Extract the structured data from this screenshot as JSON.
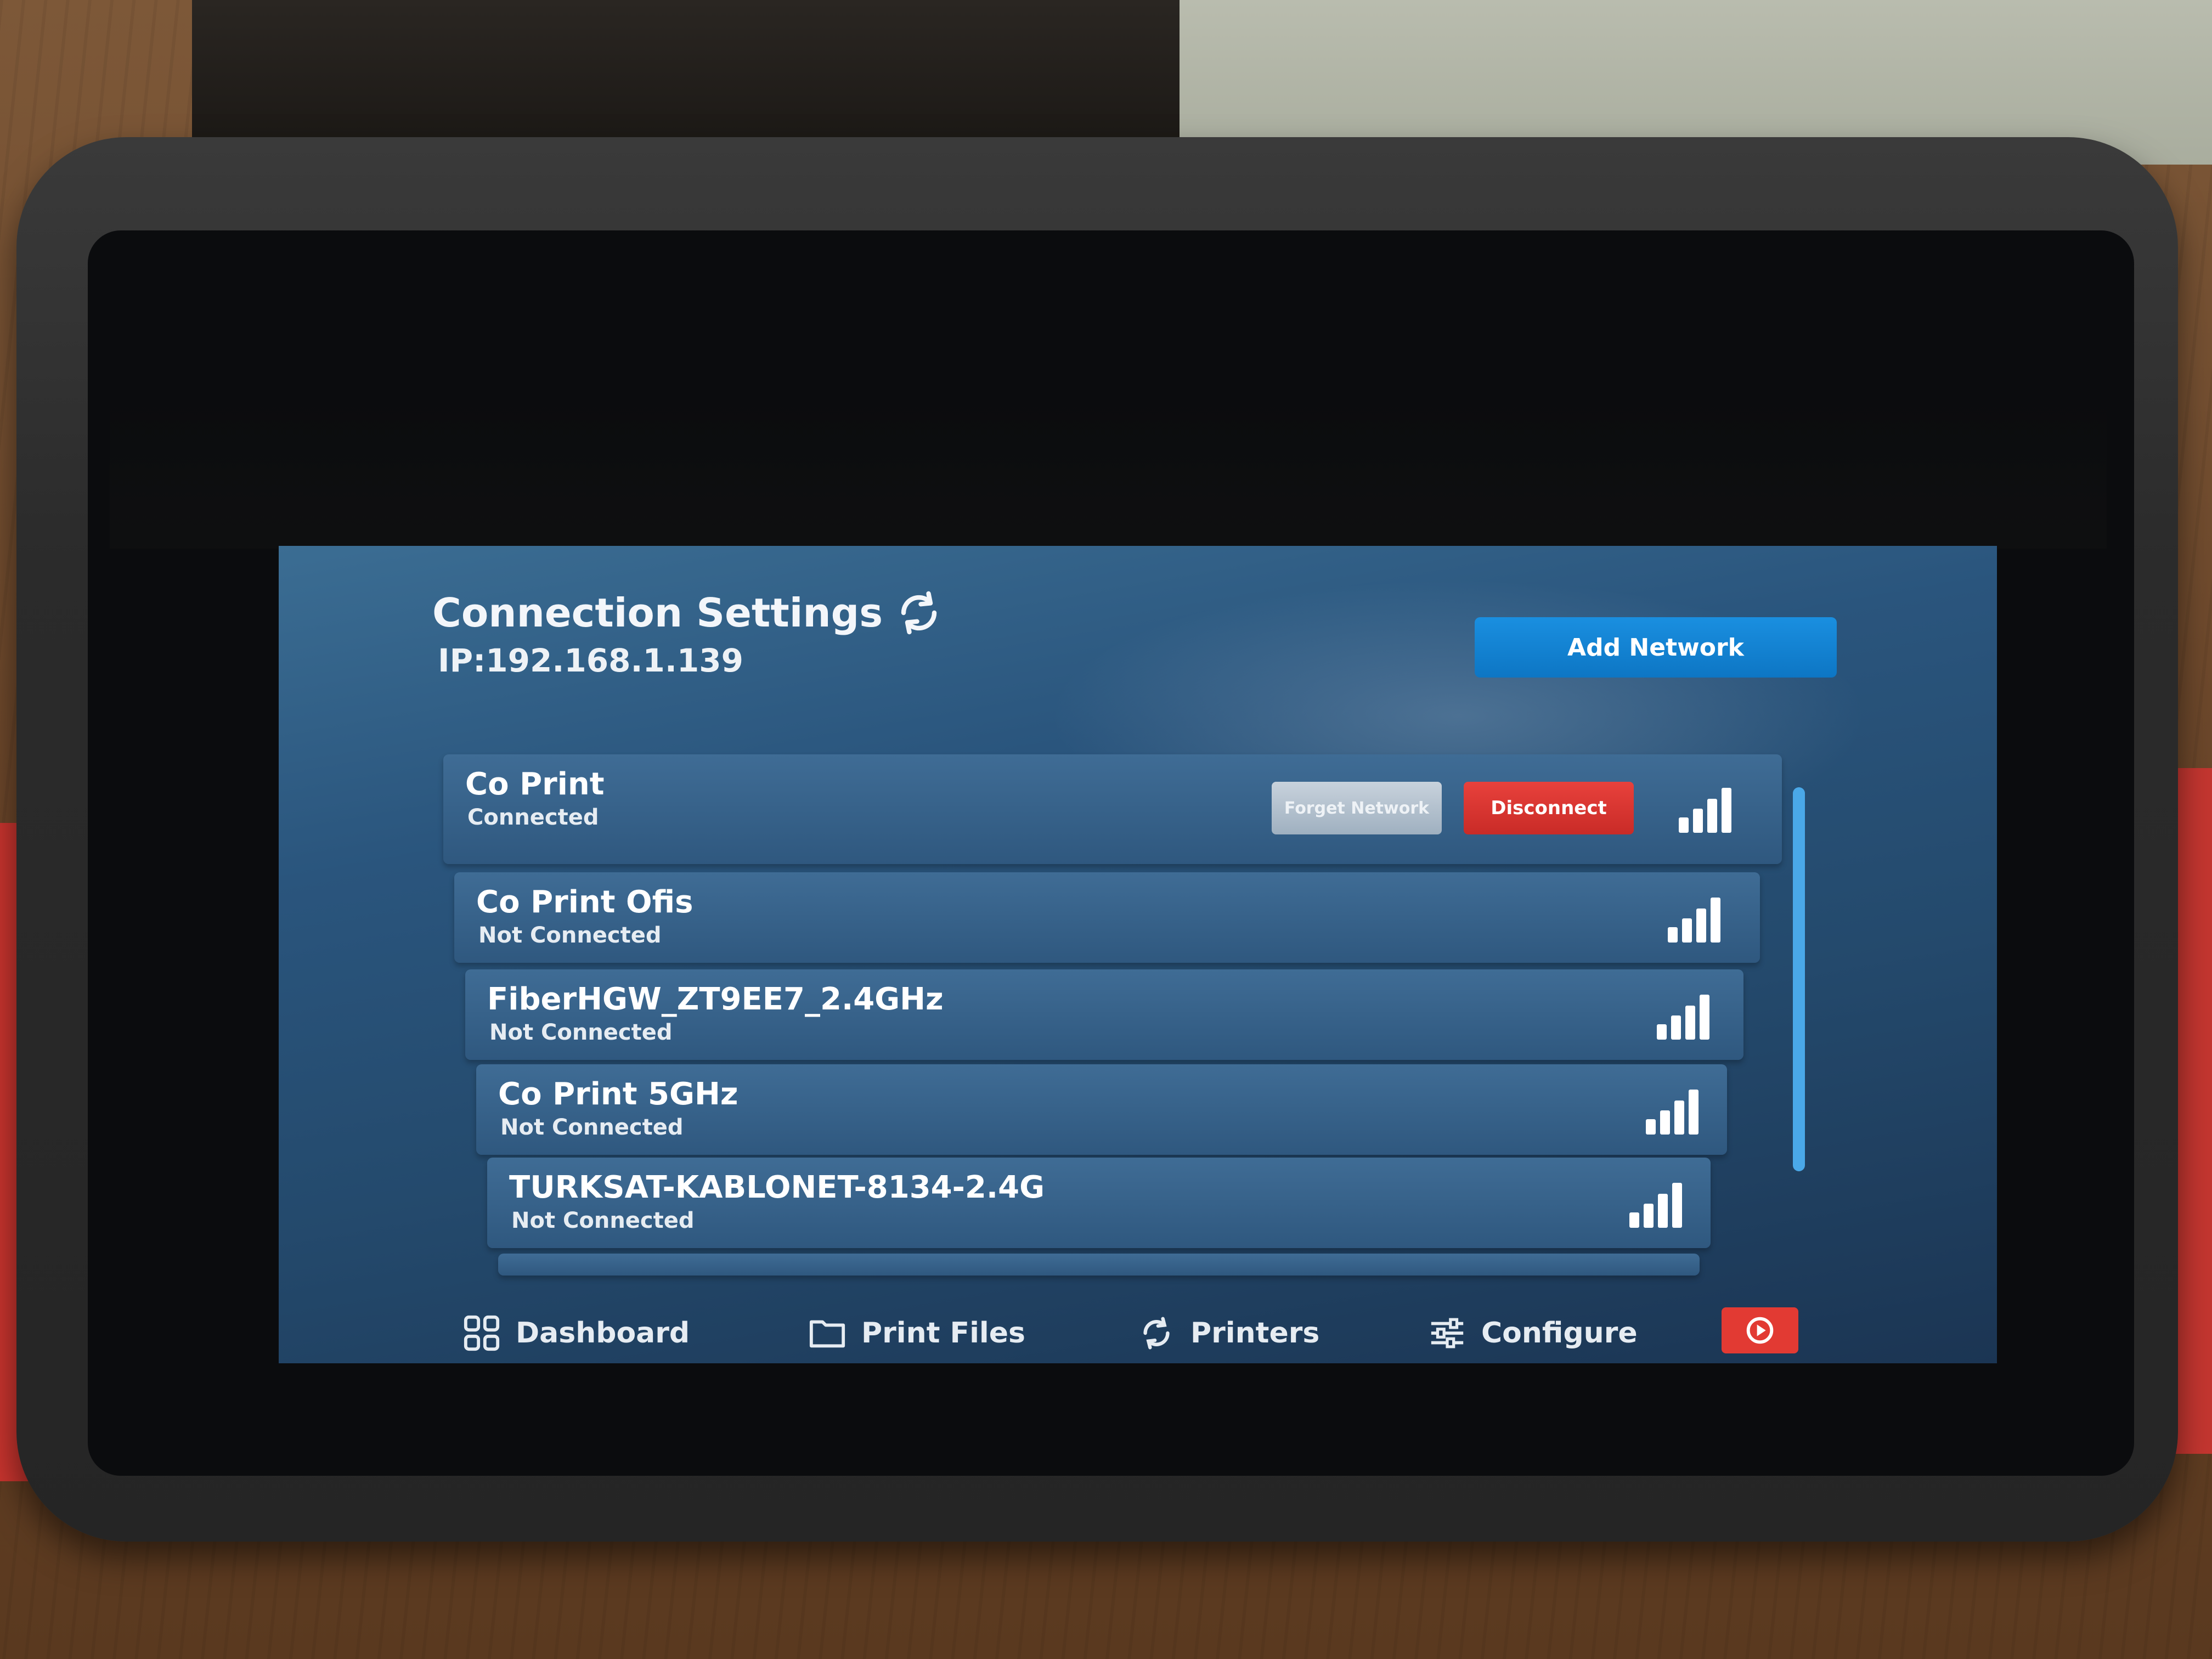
{
  "header": {
    "title": "Connection Settings",
    "ip": "IP:192.168.1.139",
    "add_network_label": "Add Network"
  },
  "networks": [
    {
      "name": "Co Print",
      "status": "Connected",
      "forget_label": "Forget Network",
      "disconnect_label": "Disconnect"
    },
    {
      "name": "Co Print Ofis",
      "status": "Not Connected"
    },
    {
      "name": "FiberHGW_ZT9EE7_2.4GHz",
      "status": "Not Connected"
    },
    {
      "name": "Co Print 5GHz",
      "status": "Not Connected"
    },
    {
      "name": "TURKSAT-KABLONET-8134-2.4G",
      "status": "Not Connected"
    }
  ],
  "nav": {
    "dashboard": "Dashboard",
    "print_files": "Print Files",
    "printers": "Printers",
    "configure": "Configure"
  },
  "colors": {
    "accent_blue": "#0d76c4",
    "danger_red": "#e23a33",
    "row_blue": "#3f6c95"
  }
}
